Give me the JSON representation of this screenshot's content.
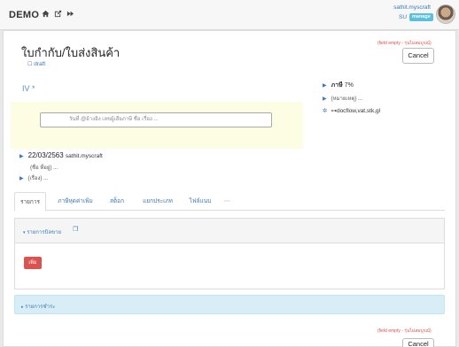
{
  "app": {
    "name": "DEMO"
  },
  "user": {
    "name": "sathit.myscraft",
    "role": "SU",
    "manage_label": "manage"
  },
  "page": {
    "title": "ใบกำกับ/ใบส่งสินค้า",
    "status": "draft",
    "field_empty_note": "(field empty - รุ่นไม่สมบูรณ์)",
    "cancel_label": "Cancel"
  },
  "form": {
    "iv_label": "IV *",
    "search_placeholder": "วันที่ @อ้างอิง เลขผู้เสียภาษี ชื่อ เรื่อง ...",
    "tax_label": "ภาษี",
    "tax_value": "7%",
    "remark": "{หมายเหตุ} ...",
    "flow": "docflow,vat,stk,gl",
    "date": "22/03/2563",
    "author": "sathit.myscraft",
    "contact": "{ชื่อ ที่อยู่} ...",
    "subject": "{เรื่อง} ..."
  },
  "tabs": [
    {
      "label": "รายการ"
    },
    {
      "label": "ภาษีหุดค่าเพิ่ม"
    },
    {
      "label": "สต็อก"
    },
    {
      "label": "แยกประเภท"
    },
    {
      "label": "ไฟล์แนบ"
    },
    {
      "label": "⋯"
    }
  ],
  "items_panel": {
    "title": "รายการบิลขาย",
    "add_label": "เพิ่ม"
  },
  "payment_panel": {
    "title": "รายการชำระ"
  },
  "colors": {
    "accent": "#3a7ab8",
    "danger": "#d9534f",
    "info_bg": "#d9edf7",
    "highlight_bg": "#fdfde3"
  }
}
